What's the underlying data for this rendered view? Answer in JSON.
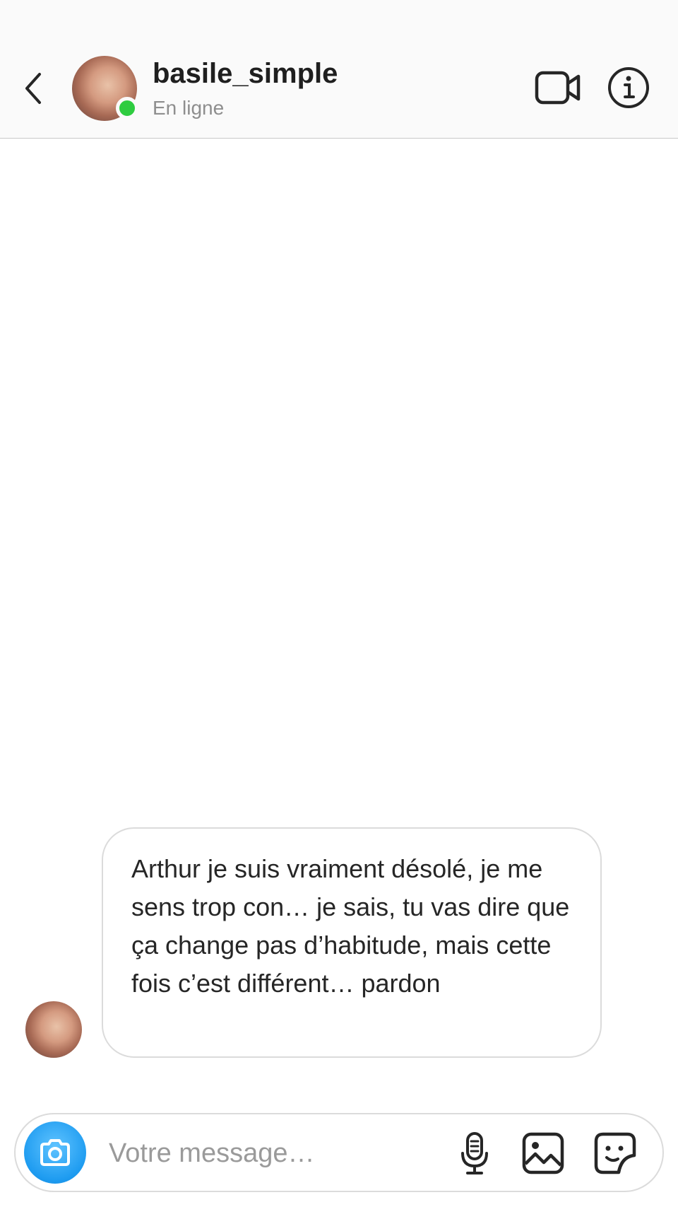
{
  "header": {
    "username": "basile_simple",
    "status": "En ligne",
    "status_color": "#2ecc40",
    "icons": {
      "back": "chevron-left-icon",
      "video": "video-camera-icon",
      "info": "info-icon"
    }
  },
  "conversation": {
    "messages": [
      {
        "direction": "incoming",
        "text": "Arthur je suis vraiment désolé, je me sens trop con… je sais, tu vas dire que ça change pas d’habitude, mais cette fois c’est différent… pardon"
      }
    ]
  },
  "composer": {
    "placeholder": "Votre message…",
    "accent_color": "#1d9bf0",
    "icons": {
      "camera": "camera-icon",
      "mic": "microphone-icon",
      "gallery": "image-gallery-icon",
      "sticker": "sticker-icon"
    }
  }
}
